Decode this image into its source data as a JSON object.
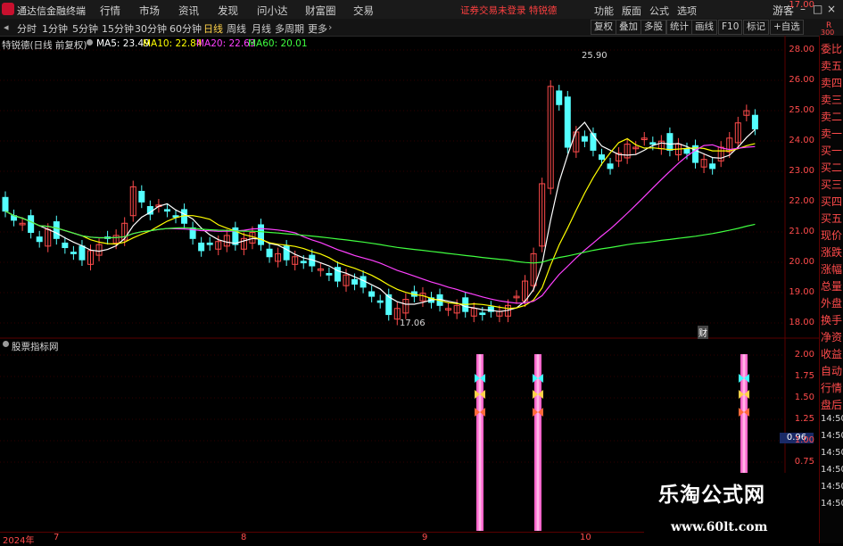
{
  "app": {
    "name": "通达信金融终端"
  },
  "menu": [
    "行情",
    "市场",
    "资讯",
    "发现",
    "问小达",
    "财富圈",
    "交易"
  ],
  "notice": "证券交易未登录  特锐德",
  "right_menu": [
    "功能",
    "版面",
    "公式",
    "选项"
  ],
  "guest_label": "游客",
  "periods": [
    "分时",
    "1分钟",
    "5分钟",
    "15分钟",
    "30分钟",
    "60分钟",
    "日线",
    "周线",
    "月线",
    "多周期",
    "更多"
  ],
  "active_period": "日线",
  "right_tools": [
    "复权",
    "叠加",
    "多股",
    "统计",
    "画线",
    "F10",
    "标记",
    "+自选"
  ],
  "stock": {
    "name": "特锐德(日线 前复权)",
    "ma": [
      {
        "label": "MA5: 23.49",
        "color": "#ffffff"
      },
      {
        "label": "MA10: 22.84",
        "color": "#ffff00"
      },
      {
        "label": "MA20: 22.63",
        "color": "#ff40ff"
      },
      {
        "label": "MA60: 20.01",
        "color": "#40ff40"
      }
    ]
  },
  "price_axis": [
    "28.00",
    "26.00",
    "25.00",
    "24.00",
    "23.00",
    "22.00",
    "21.00",
    "20.00",
    "19.00",
    "18.00",
    "17.00"
  ],
  "annotations": {
    "high": "25.90",
    "low": "17.06",
    "cai": "财"
  },
  "indicator": {
    "title": "股票指标网",
    "axis": [
      "2.00",
      "1.75",
      "1.50",
      "1.25",
      "1.00",
      "0.75"
    ],
    "current": "0.96"
  },
  "date_axis": [
    "2024年",
    "7",
    "8",
    "9",
    "10"
  ],
  "right_panel": {
    "top_label": "R",
    "code": "300",
    "items": [
      "委比",
      "卖五",
      "卖四",
      "卖三",
      "卖二",
      "卖一",
      "买一",
      "买二",
      "买三",
      "买四",
      "买五",
      "现价",
      "涨跌",
      "涨幅",
      "总量",
      "外盘",
      "换手",
      "净资",
      "收益",
      "自动",
      "行情",
      "盘后",
      "14:50",
      "14:50",
      "14:50",
      "14:50",
      "14:50",
      "14:50"
    ]
  },
  "watermark": {
    "title": "乐淘公式网",
    "url": "www.60lt.com"
  },
  "colors": {
    "up": "#ff4b4b",
    "down": "#54ffff",
    "ma5": "#ffffff",
    "ma10": "#ffff00",
    "ma20": "#ff40ff",
    "ma60": "#40ff40",
    "signal": "#ff66cc"
  }
}
